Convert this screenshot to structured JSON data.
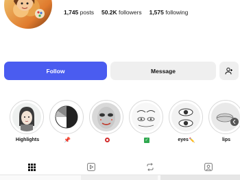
{
  "profile": {
    "stats": [
      {
        "value": "1,745",
        "label": "posts"
      },
      {
        "value": "50.2K",
        "label": "followers"
      },
      {
        "value": "1,575",
        "label": "following"
      }
    ]
  },
  "actions": {
    "follow_label": "Follow",
    "message_label": "Message",
    "add_user_icon": "add-user-icon"
  },
  "highlights": [
    {
      "label": "Highlights",
      "icon": ""
    },
    {
      "label": "",
      "icon": "pushpin"
    },
    {
      "label": "",
      "icon": "red-circle"
    },
    {
      "label": "",
      "icon": "green-check"
    },
    {
      "label": "eyes",
      "icon": "pencil"
    },
    {
      "label": "lips",
      "icon": ""
    }
  ],
  "tabs": [
    {
      "name": "posts-grid",
      "icon": "grid-icon",
      "active": true
    },
    {
      "name": "reels",
      "icon": "reels-icon",
      "active": false
    },
    {
      "name": "reposts",
      "icon": "repost-icon",
      "active": false
    },
    {
      "name": "tagged",
      "icon": "tagged-icon",
      "active": false
    }
  ],
  "colors": {
    "follow": "#4a5cf0",
    "secondary": "#efefef"
  }
}
